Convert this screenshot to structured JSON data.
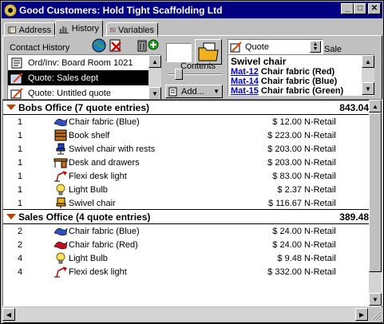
{
  "window": {
    "title": "Good Customers: Hold Tight Scaffolding Ltd",
    "btn_min": "_",
    "btn_max": "□",
    "btn_close": "✕"
  },
  "tabs": [
    {
      "label": "Address",
      "icon": "address-book-icon"
    },
    {
      "label": "History",
      "icon": "bar-chart-icon"
    },
    {
      "label": "Variables",
      "icon": "variables-icon"
    }
  ],
  "contact_history": {
    "label": "Contact History",
    "items": [
      {
        "text": "Ord/Inv:  Board Room   1021",
        "icon": "order-icon",
        "selected": false
      },
      {
        "text": "Quote:  Sales dept",
        "icon": "quote-pen-icon",
        "selected": true
      },
      {
        "text": "Quote:  Untitled quote",
        "icon": "quote-pen-icon",
        "selected": false
      }
    ]
  },
  "contents": {
    "label": "Contents",
    "add_button": "Add..."
  },
  "quote_dropdown": {
    "value": "Quote",
    "sale_reminders_label": "Sale reminders"
  },
  "sale_reminders": {
    "product": "Swivel chair",
    "items": [
      {
        "code": "Mat-12",
        "text": "Chair fabric (Red)"
      },
      {
        "code": "Mat-14",
        "text": "Chair fabric (Blue)"
      },
      {
        "code": "Mat-15",
        "text": "Chair fabric (Green)"
      }
    ]
  },
  "groups": [
    {
      "title": "Bobs Office (7 quote entries)",
      "total": "843.04",
      "lines": [
        {
          "qty": "1",
          "icon": "fabric-blue-icon",
          "desc": "Chair fabric (Blue)",
          "price": "$ 12.00",
          "retail": "N-Retail"
        },
        {
          "qty": "1",
          "icon": "bookshelf-icon",
          "desc": "Book shelf",
          "price": "$ 223.00",
          "retail": "N-Retail"
        },
        {
          "qty": "1",
          "icon": "swivel-chair-icon",
          "desc": "Swivel chair with rests",
          "price": "$ 203.00",
          "retail": "N-Retail"
        },
        {
          "qty": "1",
          "icon": "desk-icon",
          "desc": "Desk and drawers",
          "price": "$ 203.00",
          "retail": "N-Retail"
        },
        {
          "qty": "1",
          "icon": "desk-light-icon",
          "desc": "Flexi desk light",
          "price": "$ 83.00",
          "retail": "N-Retail"
        },
        {
          "qty": "1",
          "icon": "light-bulb-icon",
          "desc": "Light Bulb",
          "price": "$ 2.37",
          "retail": "N-Retail"
        },
        {
          "qty": "1",
          "icon": "swivel-chair-icon",
          "desc": "Swivel chair",
          "price": "$ 116.67",
          "retail": "N-Retail"
        }
      ]
    },
    {
      "title": "Sales Office (4 quote entries)",
      "total": "389.48",
      "lines": [
        {
          "qty": "2",
          "icon": "fabric-blue-icon",
          "desc": "Chair fabric (Blue)",
          "price": "$ 24.00",
          "retail": "N-Retail"
        },
        {
          "qty": "2",
          "icon": "fabric-red-icon",
          "desc": "Chair fabric (Red)",
          "price": "$ 24.00",
          "retail": "N-Retail"
        },
        {
          "qty": "4",
          "icon": "light-bulb-icon",
          "desc": "Light Bulb",
          "price": "$ 9.48",
          "retail": "N-Retail"
        },
        {
          "qty": "4",
          "icon": "desk-light-icon",
          "desc": "Flexi desk light",
          "price": "$ 332.00",
          "retail": "N-Retail"
        }
      ]
    }
  ],
  "colors": {
    "titlebar": "#000080",
    "group_triangle": "#c04000",
    "link": "#0000c0",
    "face": "#c0c0c0"
  }
}
